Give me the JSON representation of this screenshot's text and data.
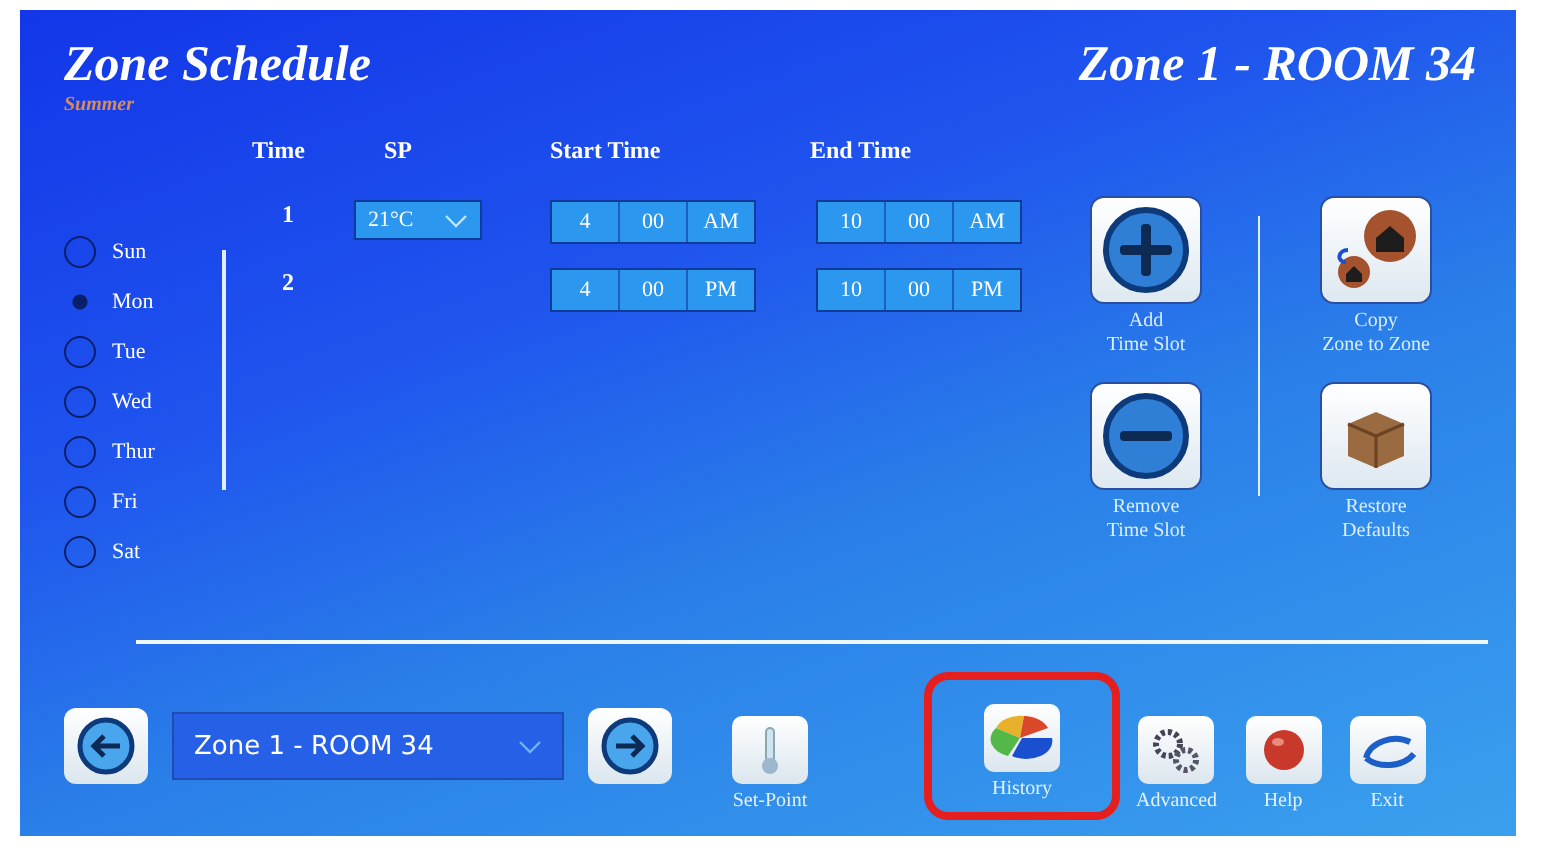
{
  "title": "Zone Schedule",
  "season": "Summer",
  "zone_title": "Zone 1 - ROOM 34",
  "columns": [
    "Time",
    "SP",
    "Start Time",
    "End Time"
  ],
  "days": [
    {
      "label": "Sun",
      "selected": false
    },
    {
      "label": "Mon",
      "selected": true
    },
    {
      "label": "Tue",
      "selected": false
    },
    {
      "label": "Wed",
      "selected": false
    },
    {
      "label": "Thur",
      "selected": false
    },
    {
      "label": "Fri",
      "selected": false
    },
    {
      "label": "Sat",
      "selected": false
    }
  ],
  "slots": [
    {
      "number": "1",
      "setpoint": "21°C",
      "start": {
        "hour": "4",
        "minute": "00",
        "period": "AM"
      },
      "end": {
        "hour": "10",
        "minute": "00",
        "period": "AM"
      }
    },
    {
      "number": "2",
      "start": {
        "hour": "4",
        "minute": "00",
        "period": "PM"
      },
      "end": {
        "hour": "10",
        "minute": "00",
        "period": "PM"
      }
    }
  ],
  "side_actions": [
    {
      "kind": "add",
      "lines": [
        "Add",
        "Time Slot"
      ]
    },
    {
      "kind": "copy",
      "lines": [
        "Copy",
        "Zone to Zone"
      ]
    },
    {
      "kind": "remove",
      "lines": [
        "Remove",
        "Time Slot"
      ]
    },
    {
      "kind": "restore",
      "lines": [
        "Restore",
        "Defaults"
      ]
    }
  ],
  "zone_select": {
    "value": "Zone 1 - ROOM 34"
  },
  "toolbar": [
    {
      "kind": "setpoint",
      "label": "Set-Point",
      "highlighted": false
    },
    {
      "kind": "history",
      "label": "History",
      "highlighted": true
    },
    {
      "kind": "advanced",
      "label": "Advanced",
      "highlighted": false
    },
    {
      "kind": "help",
      "label": "Help",
      "highlighted": false
    },
    {
      "kind": "exit",
      "label": "Exit",
      "highlighted": false
    }
  ]
}
